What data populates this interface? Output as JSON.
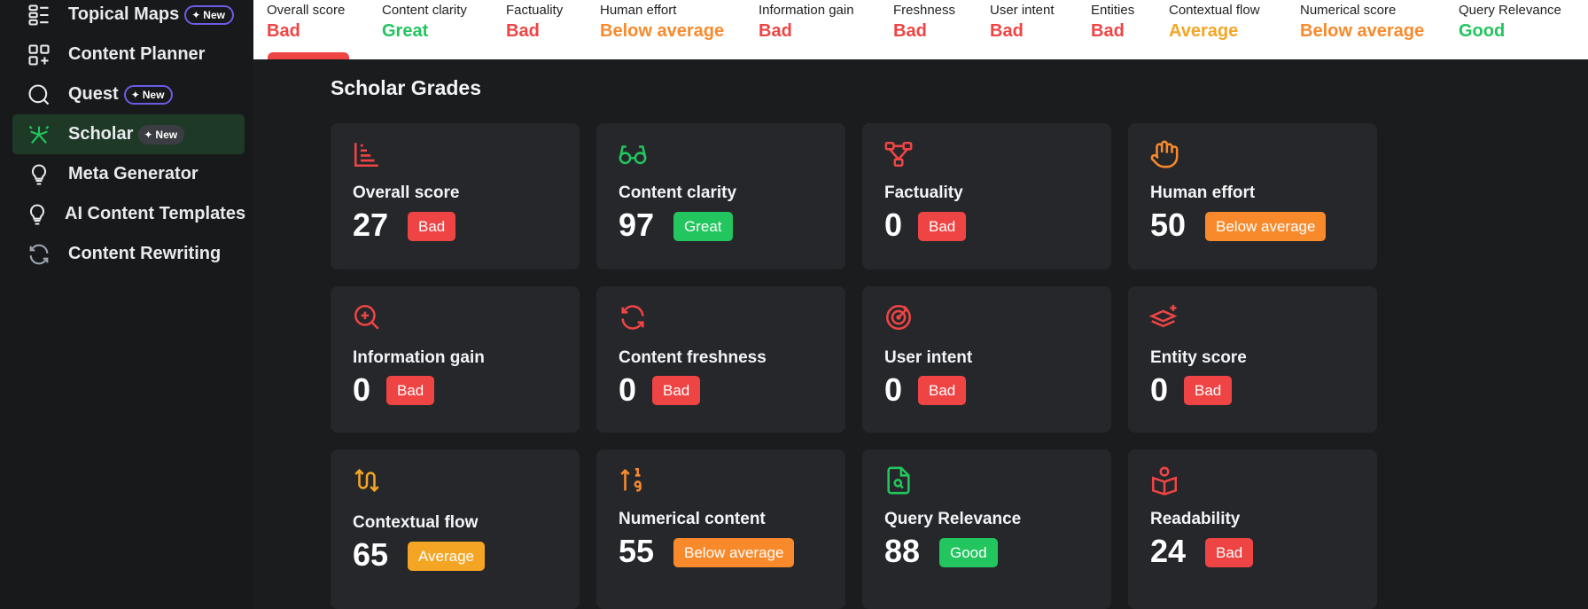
{
  "colors": {
    "bad": "#ef4444",
    "great": "#22c55e",
    "good": "#22c55e",
    "below_average": "#f98a2c",
    "average": "#f5a524"
  },
  "sidebar": {
    "items": [
      {
        "label": "Topical Maps",
        "icon": "topical-maps-icon",
        "badge": "New"
      },
      {
        "label": "Content Planner",
        "icon": "content-planner-icon"
      },
      {
        "label": "Quest",
        "icon": "quest-icon",
        "badge": "New"
      },
      {
        "label": "Scholar",
        "icon": "scholar-icon",
        "badge": "New",
        "active": true
      },
      {
        "label": "Meta Generator",
        "icon": "lightbulb-icon"
      },
      {
        "label": "AI Content Templates",
        "icon": "lightbulb-icon"
      },
      {
        "label": "Content Rewriting",
        "icon": "rewrite-icon"
      }
    ]
  },
  "topbar": {
    "metrics": [
      {
        "label": "Overall score",
        "value": "Bad",
        "status": "bad"
      },
      {
        "label": "Content clarity",
        "value": "Great",
        "status": "great"
      },
      {
        "label": "Factuality",
        "value": "Bad",
        "status": "bad"
      },
      {
        "label": "Human effort",
        "value": "Below average",
        "status": "below_average"
      },
      {
        "label": "Information gain",
        "value": "Bad",
        "status": "bad"
      },
      {
        "label": "Freshness",
        "value": "Bad",
        "status": "bad"
      },
      {
        "label": "User intent",
        "value": "Bad",
        "status": "bad"
      },
      {
        "label": "Entities",
        "value": "Bad",
        "status": "bad"
      },
      {
        "label": "Contextual flow",
        "value": "Average",
        "status": "average"
      },
      {
        "label": "Numerical score",
        "value": "Below average",
        "status": "below_average"
      },
      {
        "label": "Query Relevance",
        "value": "Good",
        "status": "good"
      }
    ]
  },
  "main": {
    "section_title": "Scholar Grades",
    "cards": [
      {
        "title": "Overall score",
        "score": "27",
        "badge": "Bad",
        "status": "bad",
        "icon": "bar-chart-icon"
      },
      {
        "title": "Content clarity",
        "score": "97",
        "badge": "Great",
        "status": "great",
        "icon": "glasses-icon"
      },
      {
        "title": "Factuality",
        "score": "0",
        "badge": "Bad",
        "status": "bad",
        "icon": "network-icon"
      },
      {
        "title": "Human effort",
        "score": "50",
        "badge": "Below average",
        "status": "below_average",
        "icon": "hand-icon"
      },
      {
        "title": "Information gain",
        "score": "0",
        "badge": "Bad",
        "status": "bad",
        "icon": "zoom-in-icon"
      },
      {
        "title": "Content freshness",
        "score": "0",
        "badge": "Bad",
        "status": "bad",
        "icon": "refresh-icon"
      },
      {
        "title": "User intent",
        "score": "0",
        "badge": "Bad",
        "status": "bad",
        "icon": "target-icon"
      },
      {
        "title": "Entity score",
        "score": "0",
        "badge": "Bad",
        "status": "bad",
        "icon": "layers-icon"
      },
      {
        "title": "Contextual flow",
        "score": "65",
        "badge": "Average",
        "status": "average",
        "icon": "flow-icon"
      },
      {
        "title": "Numerical content",
        "score": "55",
        "badge": "Below average",
        "status": "below_average",
        "icon": "sort-numeric-icon"
      },
      {
        "title": "Query Relevance",
        "score": "88",
        "badge": "Good",
        "status": "good",
        "icon": "file-search-icon"
      },
      {
        "title": "Readability",
        "score": "24",
        "badge": "Bad",
        "status": "bad",
        "icon": "book-reader-icon"
      }
    ]
  }
}
